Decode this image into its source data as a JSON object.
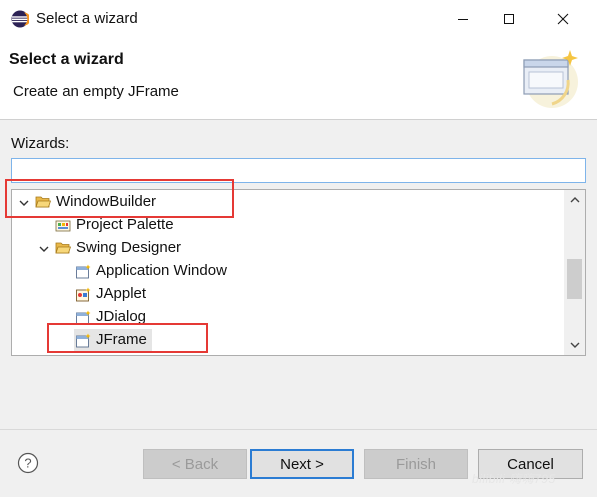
{
  "window": {
    "title": "Select a wizard",
    "icon": "eclipse-icon"
  },
  "header": {
    "title": "Select a wizard",
    "description": "Create an empty JFrame",
    "image": "wizard-banner-icon"
  },
  "filter": {
    "label": "Wizards:",
    "value": ""
  },
  "tree": {
    "nodes": [
      {
        "label": "WindowBuilder",
        "level": 0,
        "expanded": true,
        "icon": "folder-open-icon",
        "selected": false
      },
      {
        "label": "Project Palette",
        "level": 1,
        "icon": "palette-icon",
        "selected": false
      },
      {
        "label": "Swing Designer",
        "level": 1,
        "expanded": true,
        "icon": "folder-open-icon",
        "selected": false
      },
      {
        "label": "Application Window",
        "level": 2,
        "icon": "window-wizard-icon",
        "selected": false
      },
      {
        "label": "JApplet",
        "level": 2,
        "icon": "applet-icon",
        "selected": false
      },
      {
        "label": "JDialog",
        "level": 2,
        "icon": "window-wizard-icon",
        "selected": false
      },
      {
        "label": "JFrame",
        "level": 2,
        "icon": "window-wizard-icon",
        "selected": true
      }
    ]
  },
  "buttons": {
    "help": "?",
    "back": "< Back",
    "next": "Next >",
    "finish": "Finish",
    "cancel": "Cancel"
  },
  "watermark": "bilibili 嗨嗨795",
  "colors": {
    "annotation": "#e53935",
    "default_button_border": "#2b7cd3",
    "filter_border": "#7eb4ea",
    "selection": "#e5e5e5"
  }
}
